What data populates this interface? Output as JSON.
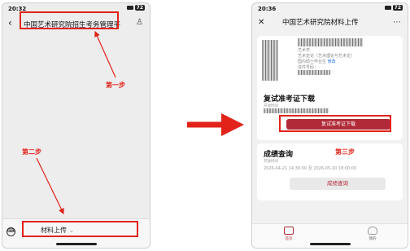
{
  "phone1": {
    "time": "20:32",
    "battery": "72",
    "back_icon": "chevron-left-icon",
    "title": "中国艺术研究院招生考务管理平",
    "profile_icon": "person-icon",
    "step1": "第一步",
    "step2": "第二步",
    "keyboard_icon": "keyboard-icon",
    "menu_label": "材料上传",
    "menu_mark": "⌄"
  },
  "phone2": {
    "time": "20:36",
    "battery": "72",
    "close_icon": "close-icon",
    "title": "中国艺术研究院材料上传",
    "more_icon": "more-icon",
    "info": {
      "line1": "艺术学",
      "line2": "艺术史论（艺术理论与艺术史）",
      "line3_prefix": "国内硕士毕业生",
      "modify": "修改",
      "line4": "证件号码："
    },
    "retest": {
      "title": "复试准考证下载",
      "opening": "开放时间",
      "button": "复试准考证下载",
      "step3": "第三步"
    },
    "score": {
      "title": "成绩查询",
      "opening": "开放时间",
      "range": "2026-04-21 14:30:00 至 2026-05-20 18:00:00",
      "button": "成绩查询"
    },
    "tabs": [
      {
        "label": "首页",
        "icon": "home-icon"
      },
      {
        "label": "我的",
        "icon": "person-icon"
      }
    ]
  },
  "colors": {
    "annotation": "#e2231a",
    "brand": "#b12a37"
  }
}
